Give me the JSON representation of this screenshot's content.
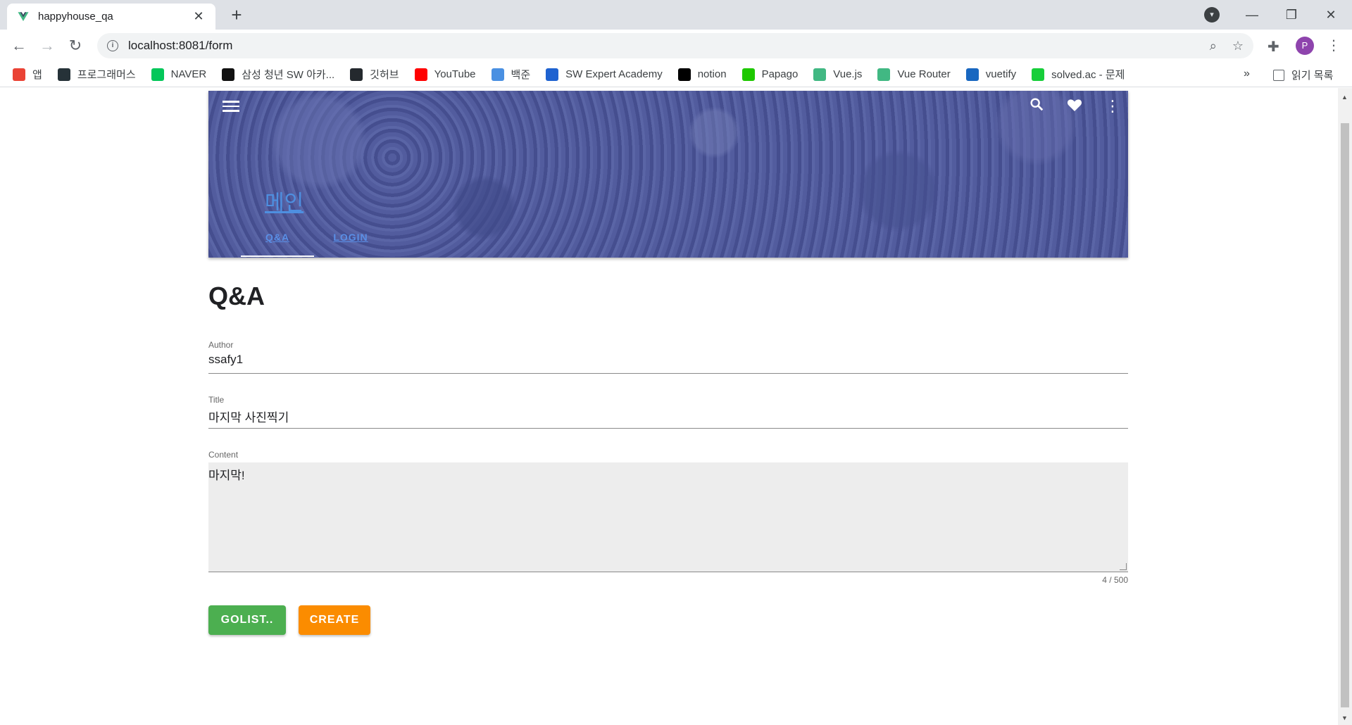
{
  "browser": {
    "tab_title": "happyhouse_qa",
    "url": "localhost:8081/form",
    "avatar_letter": "P",
    "bookmarks": [
      {
        "label": "앱",
        "color": "#ea4335"
      },
      {
        "label": "프로그래머스",
        "color": "#263238"
      },
      {
        "label": "NAVER",
        "color": "#03c75a"
      },
      {
        "label": "삼성 청년 SW 아카...",
        "color": "#111111"
      },
      {
        "label": "깃허브",
        "color": "#24292e"
      },
      {
        "label": "YouTube",
        "color": "#ff0000"
      },
      {
        "label": "백준",
        "color": "#4a90e2"
      },
      {
        "label": "SW Expert Academy",
        "color": "#1e62d0"
      },
      {
        "label": "notion",
        "color": "#000000"
      },
      {
        "label": "Papago",
        "color": "#1ec800"
      },
      {
        "label": "Vue.js",
        "color": "#41b883"
      },
      {
        "label": "Vue Router",
        "color": "#41b883"
      },
      {
        "label": "vuetify",
        "color": "#1867c0"
      },
      {
        "label": "solved.ac - 문제",
        "color": "#17ce3a"
      }
    ],
    "reading_list": "읽기 목록",
    "more": "»"
  },
  "header": {
    "brand": "메인",
    "tabs": [
      {
        "label": "Q&A"
      },
      {
        "label": "LOGIN"
      }
    ]
  },
  "form": {
    "page_title": "Q&A",
    "author_label": "Author",
    "author_value": "ssafy1",
    "title_label": "Title",
    "title_value": "마지막 사진찍기",
    "content_label": "Content",
    "content_value": "마지막!",
    "counter": "4 / 500",
    "golist_label": "GOLIST..",
    "create_label": "CREATE"
  },
  "colors": {
    "golist": "#4caf50",
    "create": "#fb8c00",
    "link": "#4e8fe0"
  }
}
